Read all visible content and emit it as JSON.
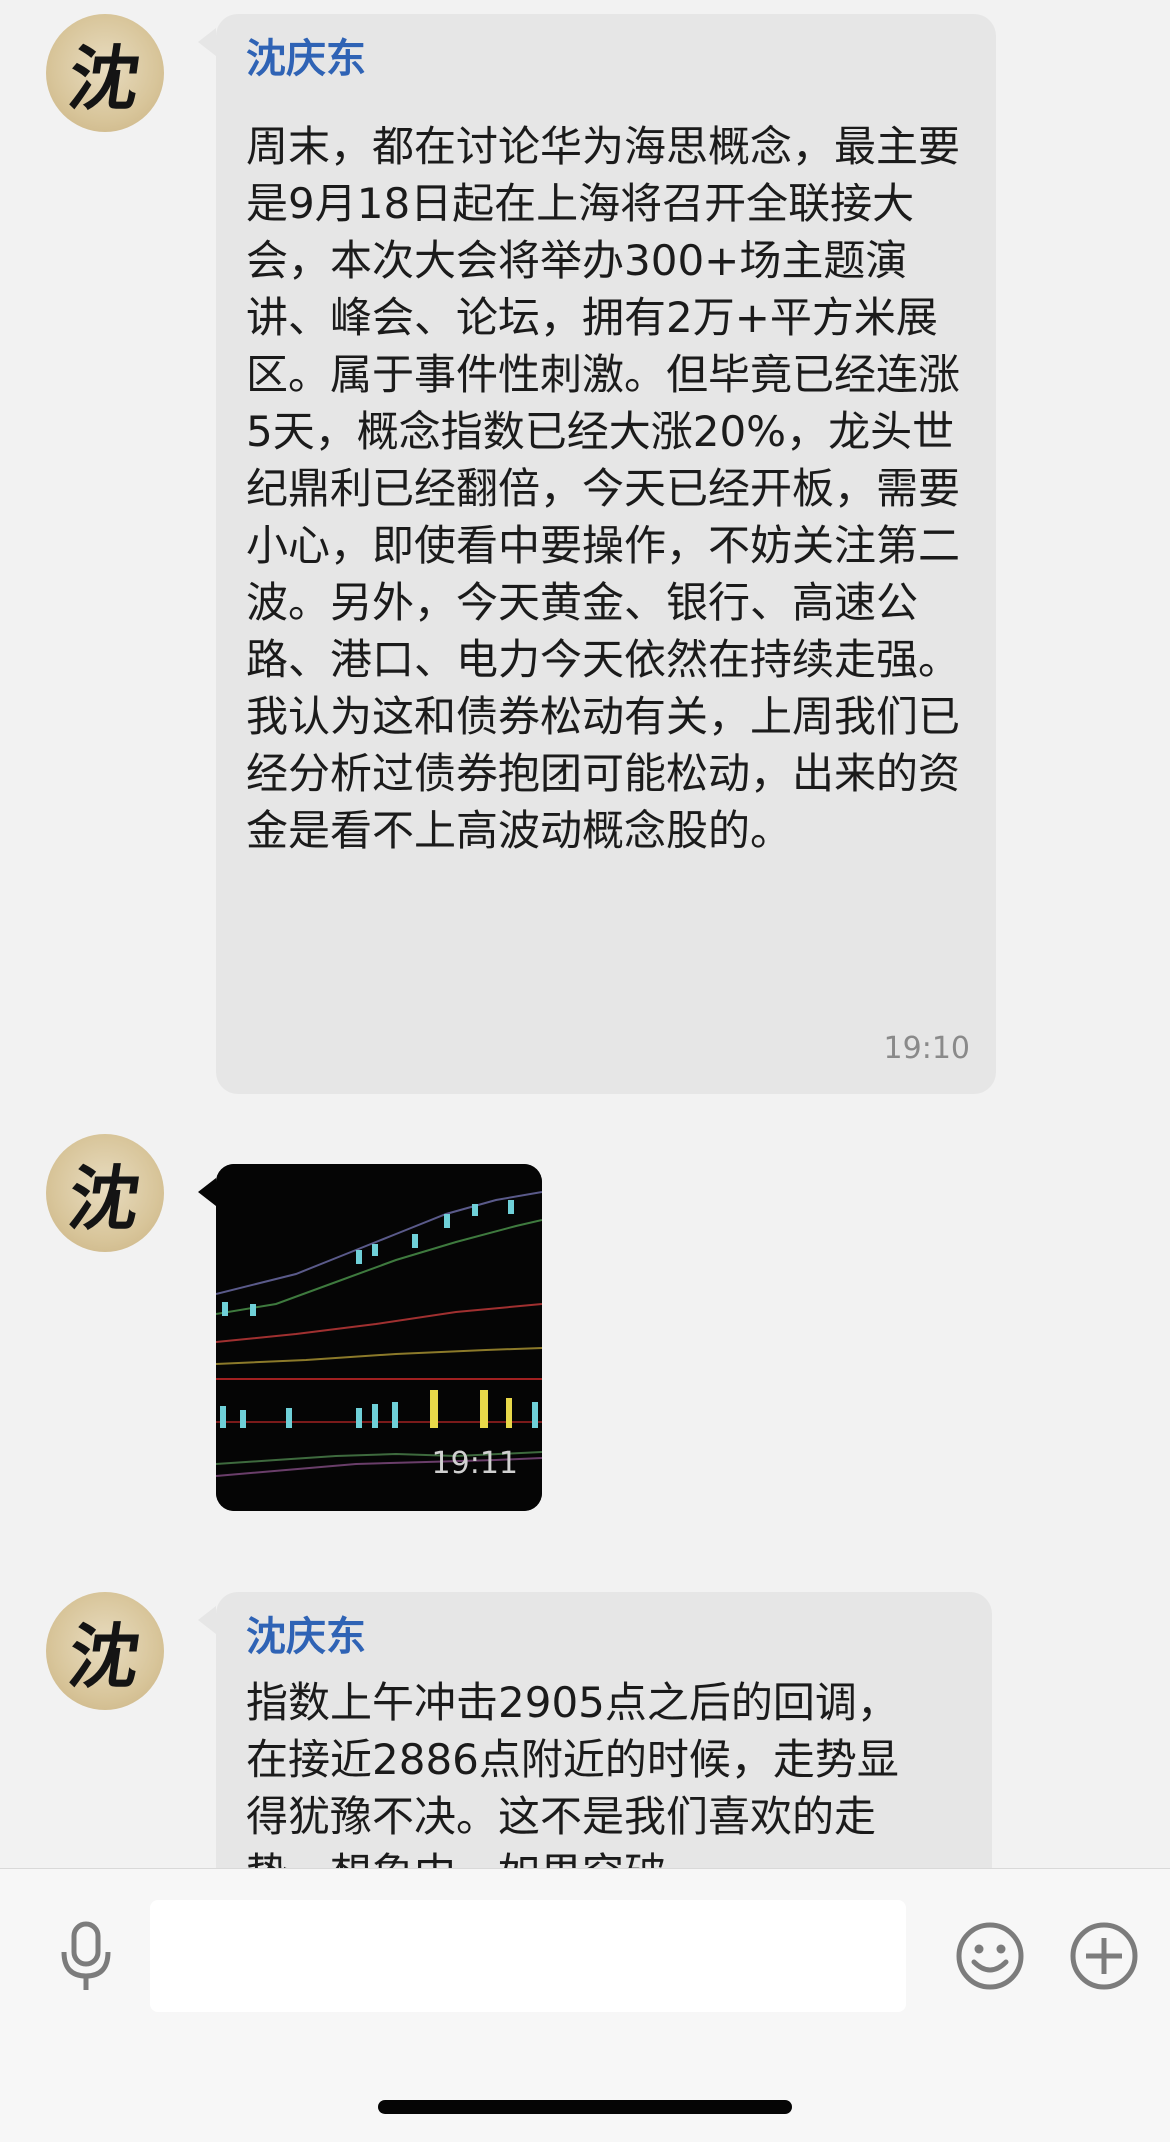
{
  "messages": [
    {
      "sender": "沈庆东",
      "avatar_char": "沈",
      "text": "周末，都在讨论华为海思概念，最主要是9月18日起在上海将召开全联接大会，本次大会将举办300+场主题演讲、峰会、论坛，拥有2万+平方米展区。属于事件性刺激。但毕竟已经连涨5天，概念指数已经大涨20%，龙头世纪鼎利已经翻倍，今天已经开板，需要小心，即使看中要操作，不妨关注第二波。另外，今天黄金、银行、高速公路、港口、电力今天依然在持续走强。我认为这和债券松动有关，上周我们已经分析过债券抱团可能松动，出来的资金是看不上高波动概念股的。",
      "time": "19:10"
    },
    {
      "avatar_char": "沈",
      "type": "image",
      "image_icon": "stock-chart-thumbnail",
      "time": "19:11"
    },
    {
      "sender": "沈庆东",
      "avatar_char": "沈",
      "text": "指数上午冲击2905点之后的回调，在接近2886点附近的时候，走势显得犹豫不决。这不是我们喜欢的走势，想象中，如果突破"
    }
  ],
  "input_bar": {
    "placeholder": "",
    "voice_icon": "microphone-icon",
    "emoji_icon": "emoji-icon",
    "plus_icon": "plus-icon"
  },
  "colors": {
    "background": "#f2f2f2",
    "bubble": "#e6e6e6",
    "sender_name": "#2f63b5",
    "icon_gray": "#7c7c7c"
  }
}
